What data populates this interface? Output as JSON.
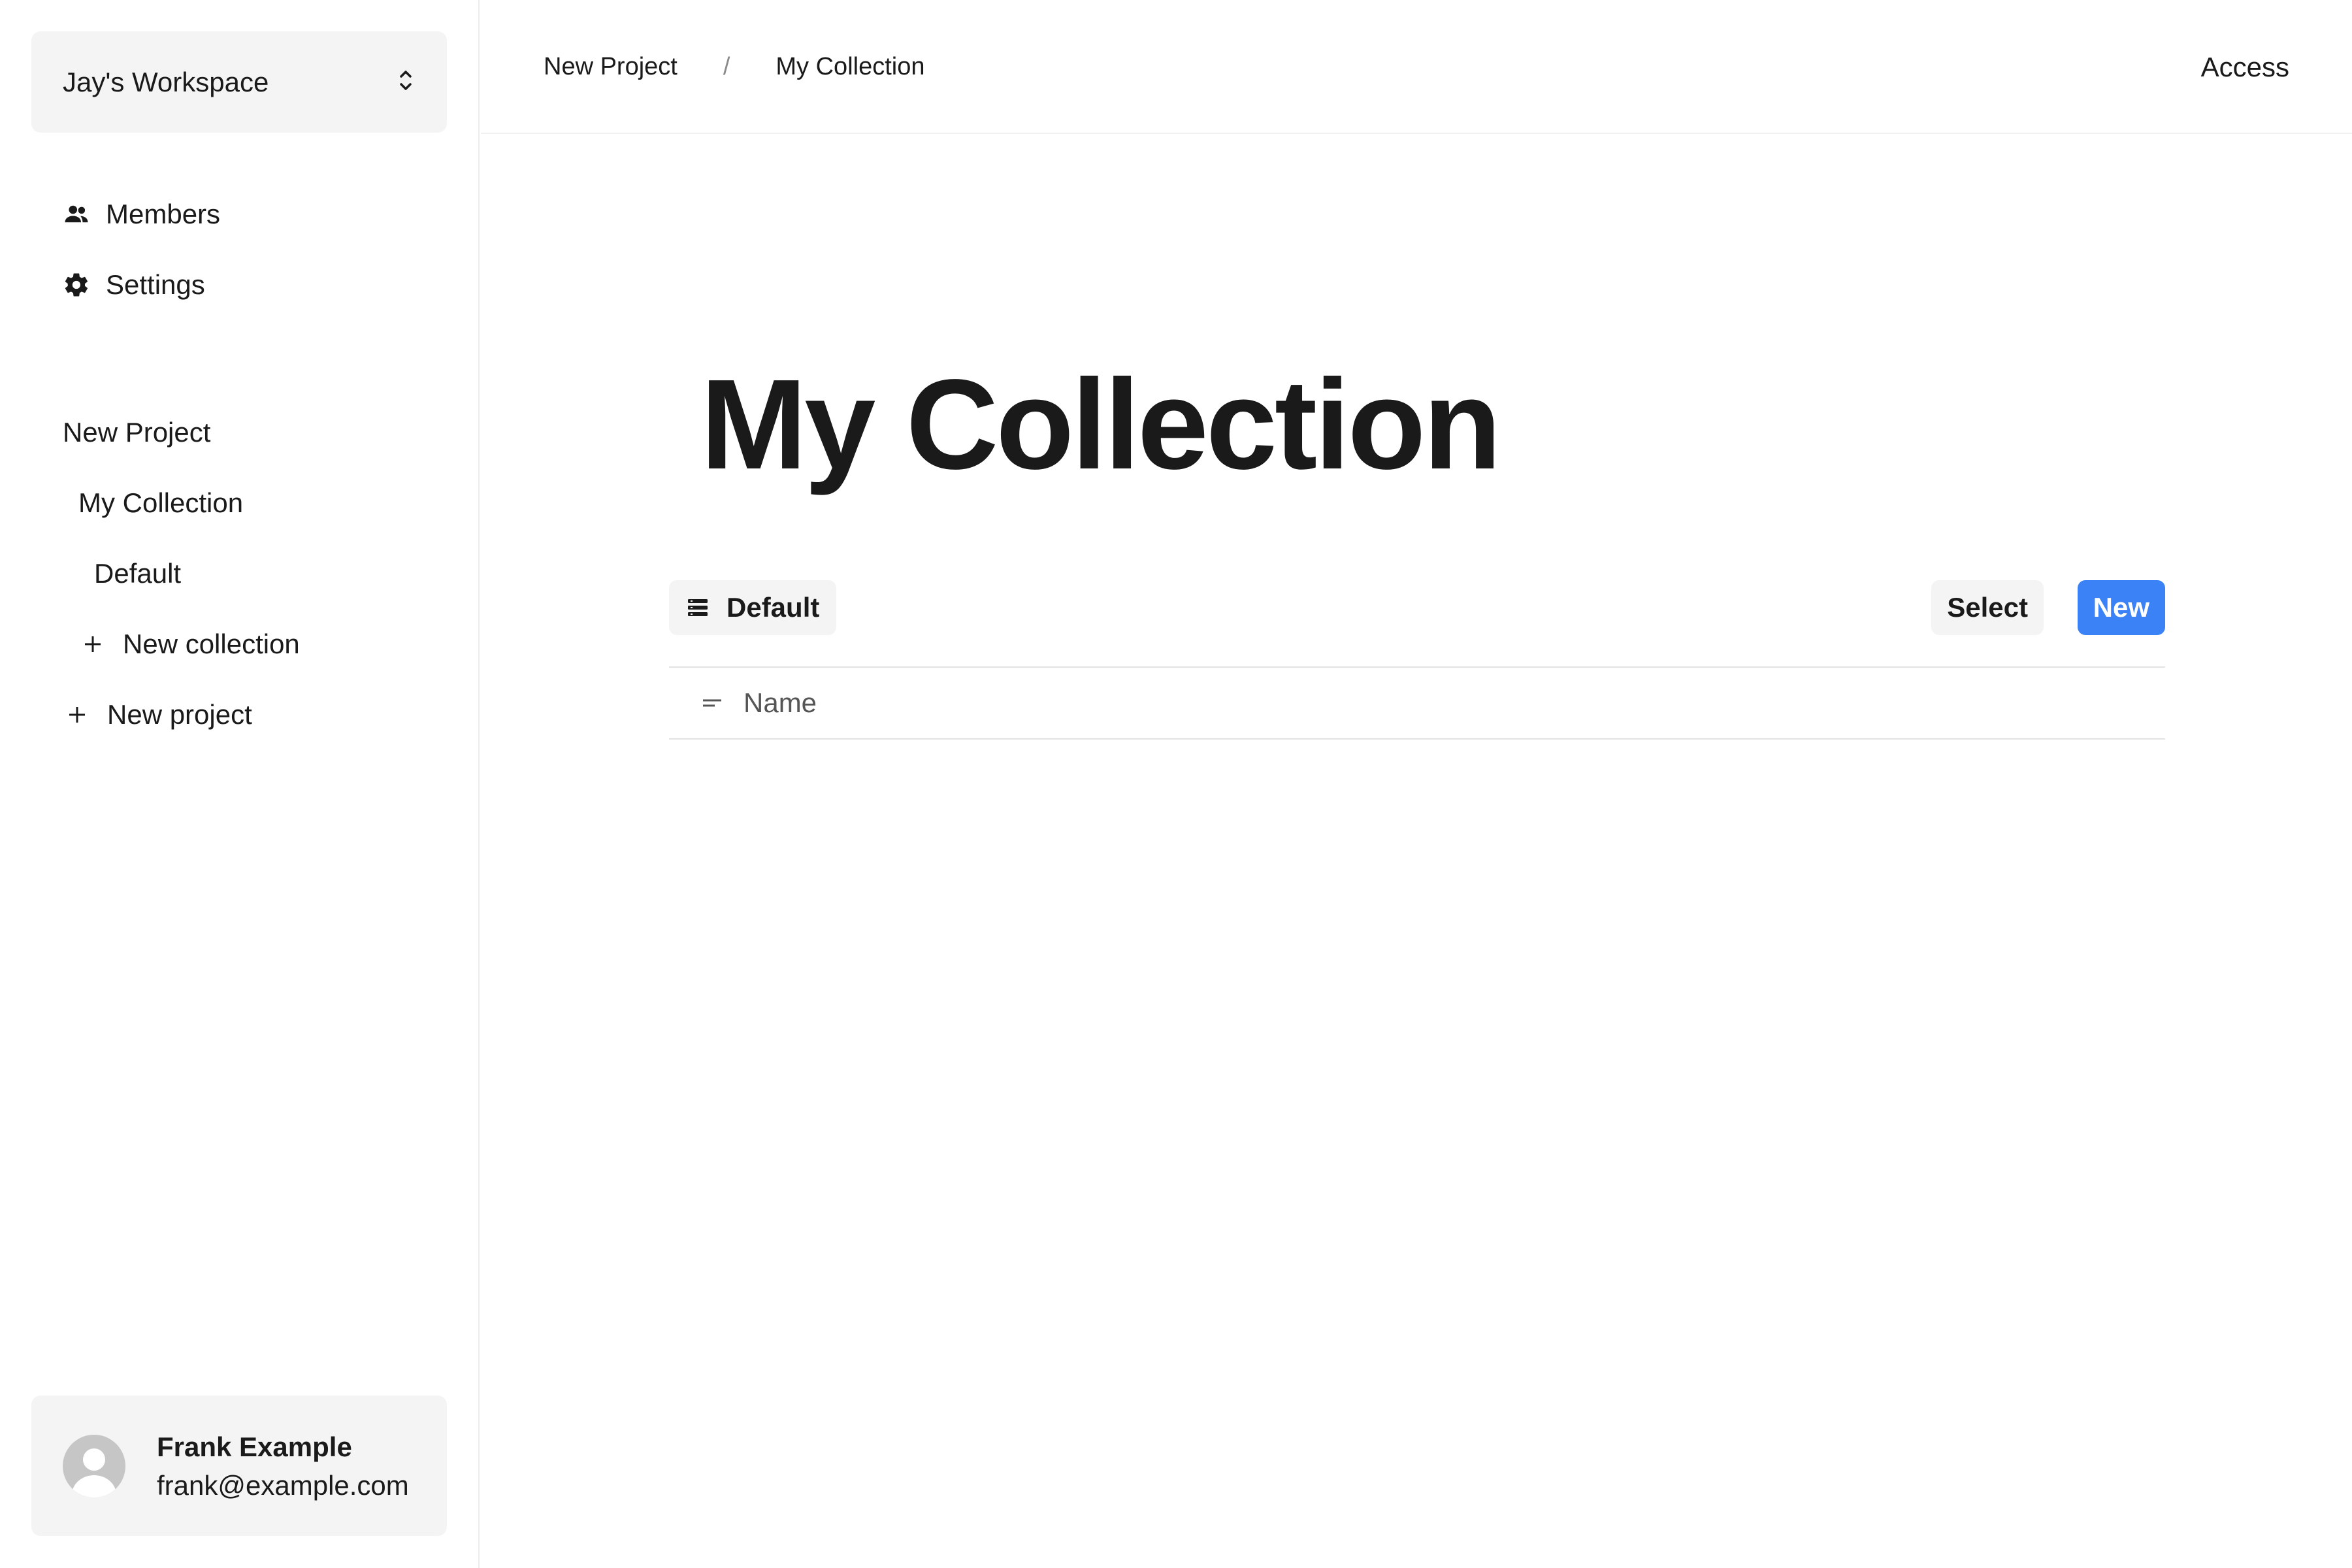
{
  "sidebar": {
    "workspace": {
      "name": "Jay's Workspace",
      "icon": "chevron-updown-icon"
    },
    "nav": [
      {
        "label": "Members",
        "icon": "members-icon"
      },
      {
        "label": "Settings",
        "icon": "gear-icon"
      }
    ],
    "tree": {
      "project": "New Project",
      "collection": "My Collection",
      "view": "Default",
      "new_collection": "New collection",
      "new_project": "New project"
    },
    "user": {
      "name": "Frank Example",
      "email": "frank@example.com"
    }
  },
  "header": {
    "breadcrumb": {
      "project": "New Project",
      "separator": "/",
      "collection": "My Collection"
    },
    "access_label": "Access"
  },
  "main": {
    "title": "My Collection",
    "toolbar": {
      "view_label": "Default",
      "select_label": "Select",
      "new_label": "New"
    },
    "table": {
      "columns": [
        {
          "label": "Name",
          "icon": "text-icon"
        }
      ]
    }
  },
  "colors": {
    "accent": "#3b82f6",
    "panel": "#f4f4f4",
    "text": "#1a1a1a",
    "divider": "#e3e3e3"
  }
}
